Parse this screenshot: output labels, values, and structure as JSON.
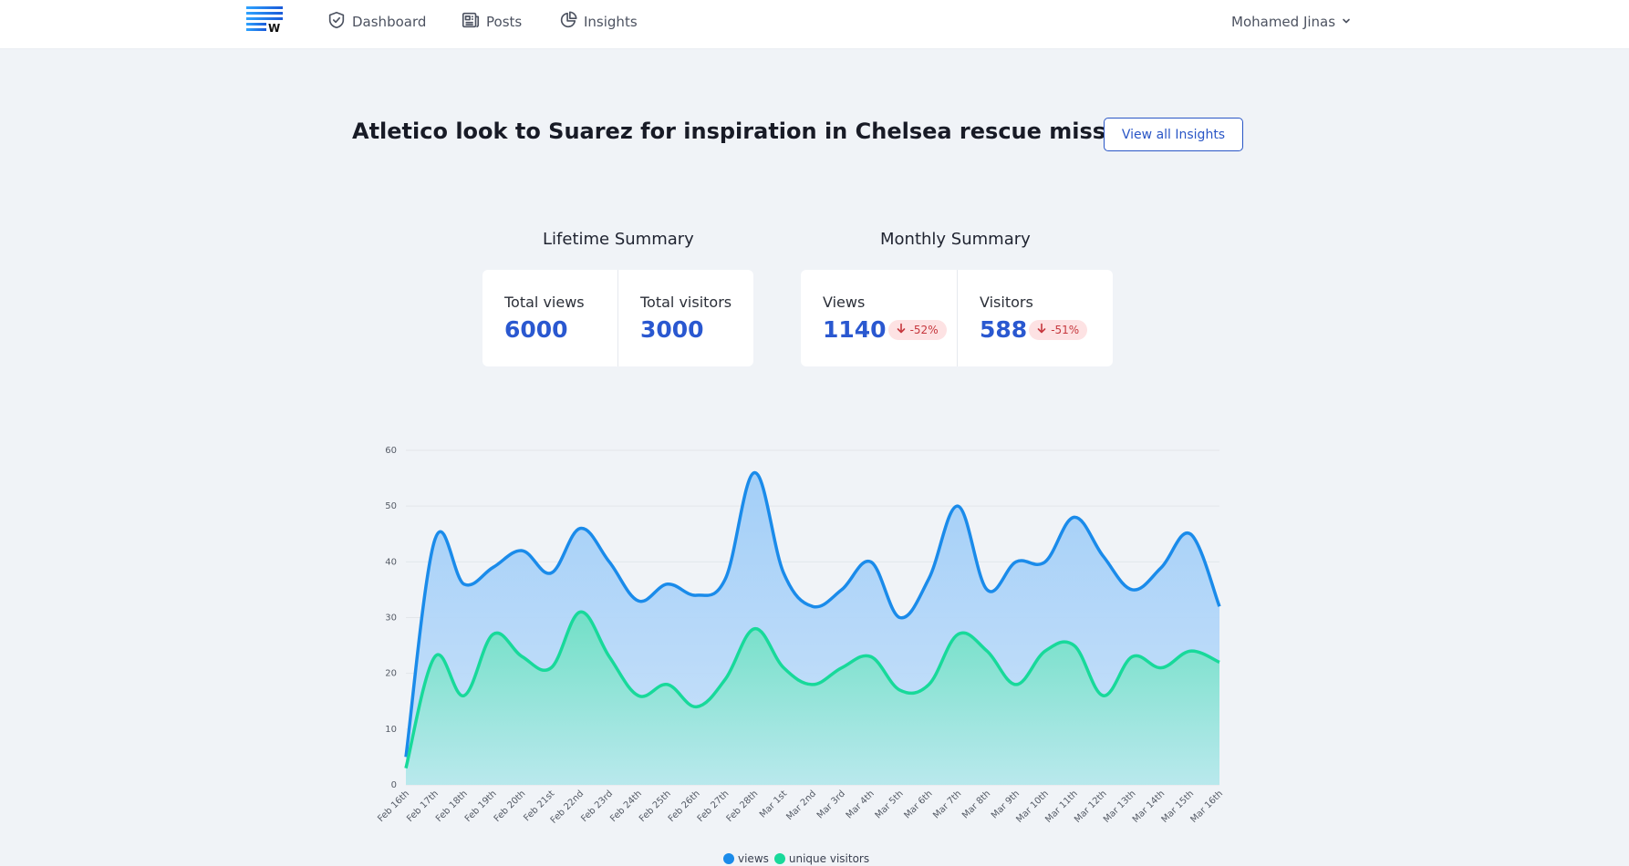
{
  "nav": {
    "logo_letter": "W",
    "items": [
      {
        "label": "Dashboard",
        "icon": "shield-check-icon"
      },
      {
        "label": "Posts",
        "icon": "newspaper-icon"
      },
      {
        "label": "Insights",
        "icon": "pie-chart-icon"
      }
    ],
    "user_name": "Mohamed Jinas"
  },
  "page": {
    "title": "Atletico look to Suarez for inspiration in Chelsea rescue mission",
    "view_all_label": "View all Insights"
  },
  "lifetime": {
    "heading": "Lifetime Summary",
    "total_views_label": "Total views",
    "total_views": "6000",
    "total_visitors_label": "Total visitors",
    "total_visitors": "3000"
  },
  "monthly": {
    "heading": "Monthly Summary",
    "views_label": "Views",
    "views": "1140",
    "views_change": "-52%",
    "visitors_label": "Visitors",
    "visitors": "588",
    "visitors_change": "-51%"
  },
  "colors": {
    "accent": "#2a58d0",
    "views": "#1a8bea",
    "visitors": "#18d99a",
    "negative": "#c6373d"
  },
  "chart_data": {
    "type": "area",
    "categories": [
      "Feb 16th",
      "Feb 17th",
      "Feb 18th",
      "Feb 19th",
      "Feb 20th",
      "Feb 21st",
      "Feb 22nd",
      "Feb 23rd",
      "Feb 24th",
      "Feb 25th",
      "Feb 26th",
      "Feb 27th",
      "Feb 28th",
      "Mar 1st",
      "Mar 2nd",
      "Mar 3rd",
      "Mar 4th",
      "Mar 5th",
      "Mar 6th",
      "Mar 7th",
      "Mar 8th",
      "Mar 9th",
      "Mar 10th",
      "Mar 11th",
      "Mar 12th",
      "Mar 13th",
      "Mar 14th",
      "Mar 15th",
      "Mar 16th"
    ],
    "series": [
      {
        "name": "views",
        "color": "#1a8bea",
        "values": [
          5,
          44,
          36,
          39,
          42,
          38,
          46,
          40,
          33,
          36,
          34,
          37,
          56,
          38,
          32,
          35,
          40,
          30,
          37,
          50,
          35,
          40,
          40,
          48,
          41,
          35,
          39,
          45,
          32
        ]
      },
      {
        "name": "unique visitors",
        "color": "#18d99a",
        "values": [
          3,
          23,
          16,
          27,
          23,
          21,
          31,
          23,
          16,
          18,
          14,
          19,
          28,
          21,
          18,
          21,
          23,
          17,
          18,
          27,
          24,
          18,
          24,
          25,
          16,
          23,
          21,
          24,
          22
        ]
      }
    ],
    "ylim": [
      0,
      60
    ],
    "yticks": [
      0,
      10,
      20,
      30,
      40,
      50,
      60
    ],
    "grid": true,
    "legend": "bottom"
  }
}
